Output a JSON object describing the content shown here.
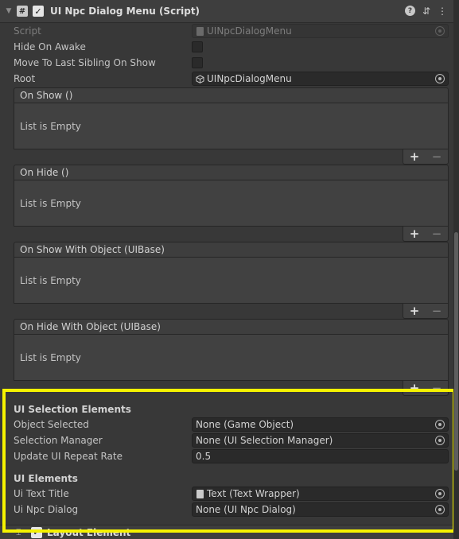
{
  "component": {
    "title": "UI Npc Dialog Menu (Script)",
    "enabled": true
  },
  "fields": {
    "script": {
      "label": "Script",
      "value": "UINpcDialogMenu"
    },
    "hide_on_awake": {
      "label": "Hide On Awake",
      "checked": false
    },
    "move_to_last_sibling": {
      "label": "Move To Last Sibling On Show",
      "checked": false
    },
    "root": {
      "label": "Root",
      "value": "UINpcDialogMenu"
    }
  },
  "events": [
    {
      "title": "On Show ()",
      "body": "List is Empty"
    },
    {
      "title": "On Hide ()",
      "body": "List is Empty"
    },
    {
      "title": "On Show With Object (UIBase)",
      "body": "List is Empty"
    },
    {
      "title": "On Hide With Object (UIBase)",
      "body": "List is Empty"
    }
  ],
  "event_buttons": {
    "add": "+",
    "remove": "−"
  },
  "selection_section": {
    "title": "UI Selection Elements",
    "object_selected": {
      "label": "Object Selected",
      "value": "None (Game Object)"
    },
    "selection_manager": {
      "label": "Selection Manager",
      "value": "None (UI Selection Manager)"
    },
    "update_repeat_rate": {
      "label": "Update UI Repeat Rate",
      "value": "0.5"
    }
  },
  "elements_section": {
    "title": "UI Elements",
    "ui_text_title": {
      "label": "Ui Text Title",
      "value": "Text (Text Wrapper)"
    },
    "ui_npc_dialog": {
      "label": "Ui Npc Dialog",
      "value": "None (UI Npc Dialog)"
    }
  },
  "next_component": {
    "title": "Layout Element"
  },
  "icons": {
    "script": "hash-script-icon",
    "check": "✓",
    "fold": "▼",
    "help": "?",
    "settings": "⇵",
    "menu": "⋮",
    "grip": "⌶"
  },
  "colors": {
    "highlight": "#f5f200",
    "background": "#383838"
  }
}
